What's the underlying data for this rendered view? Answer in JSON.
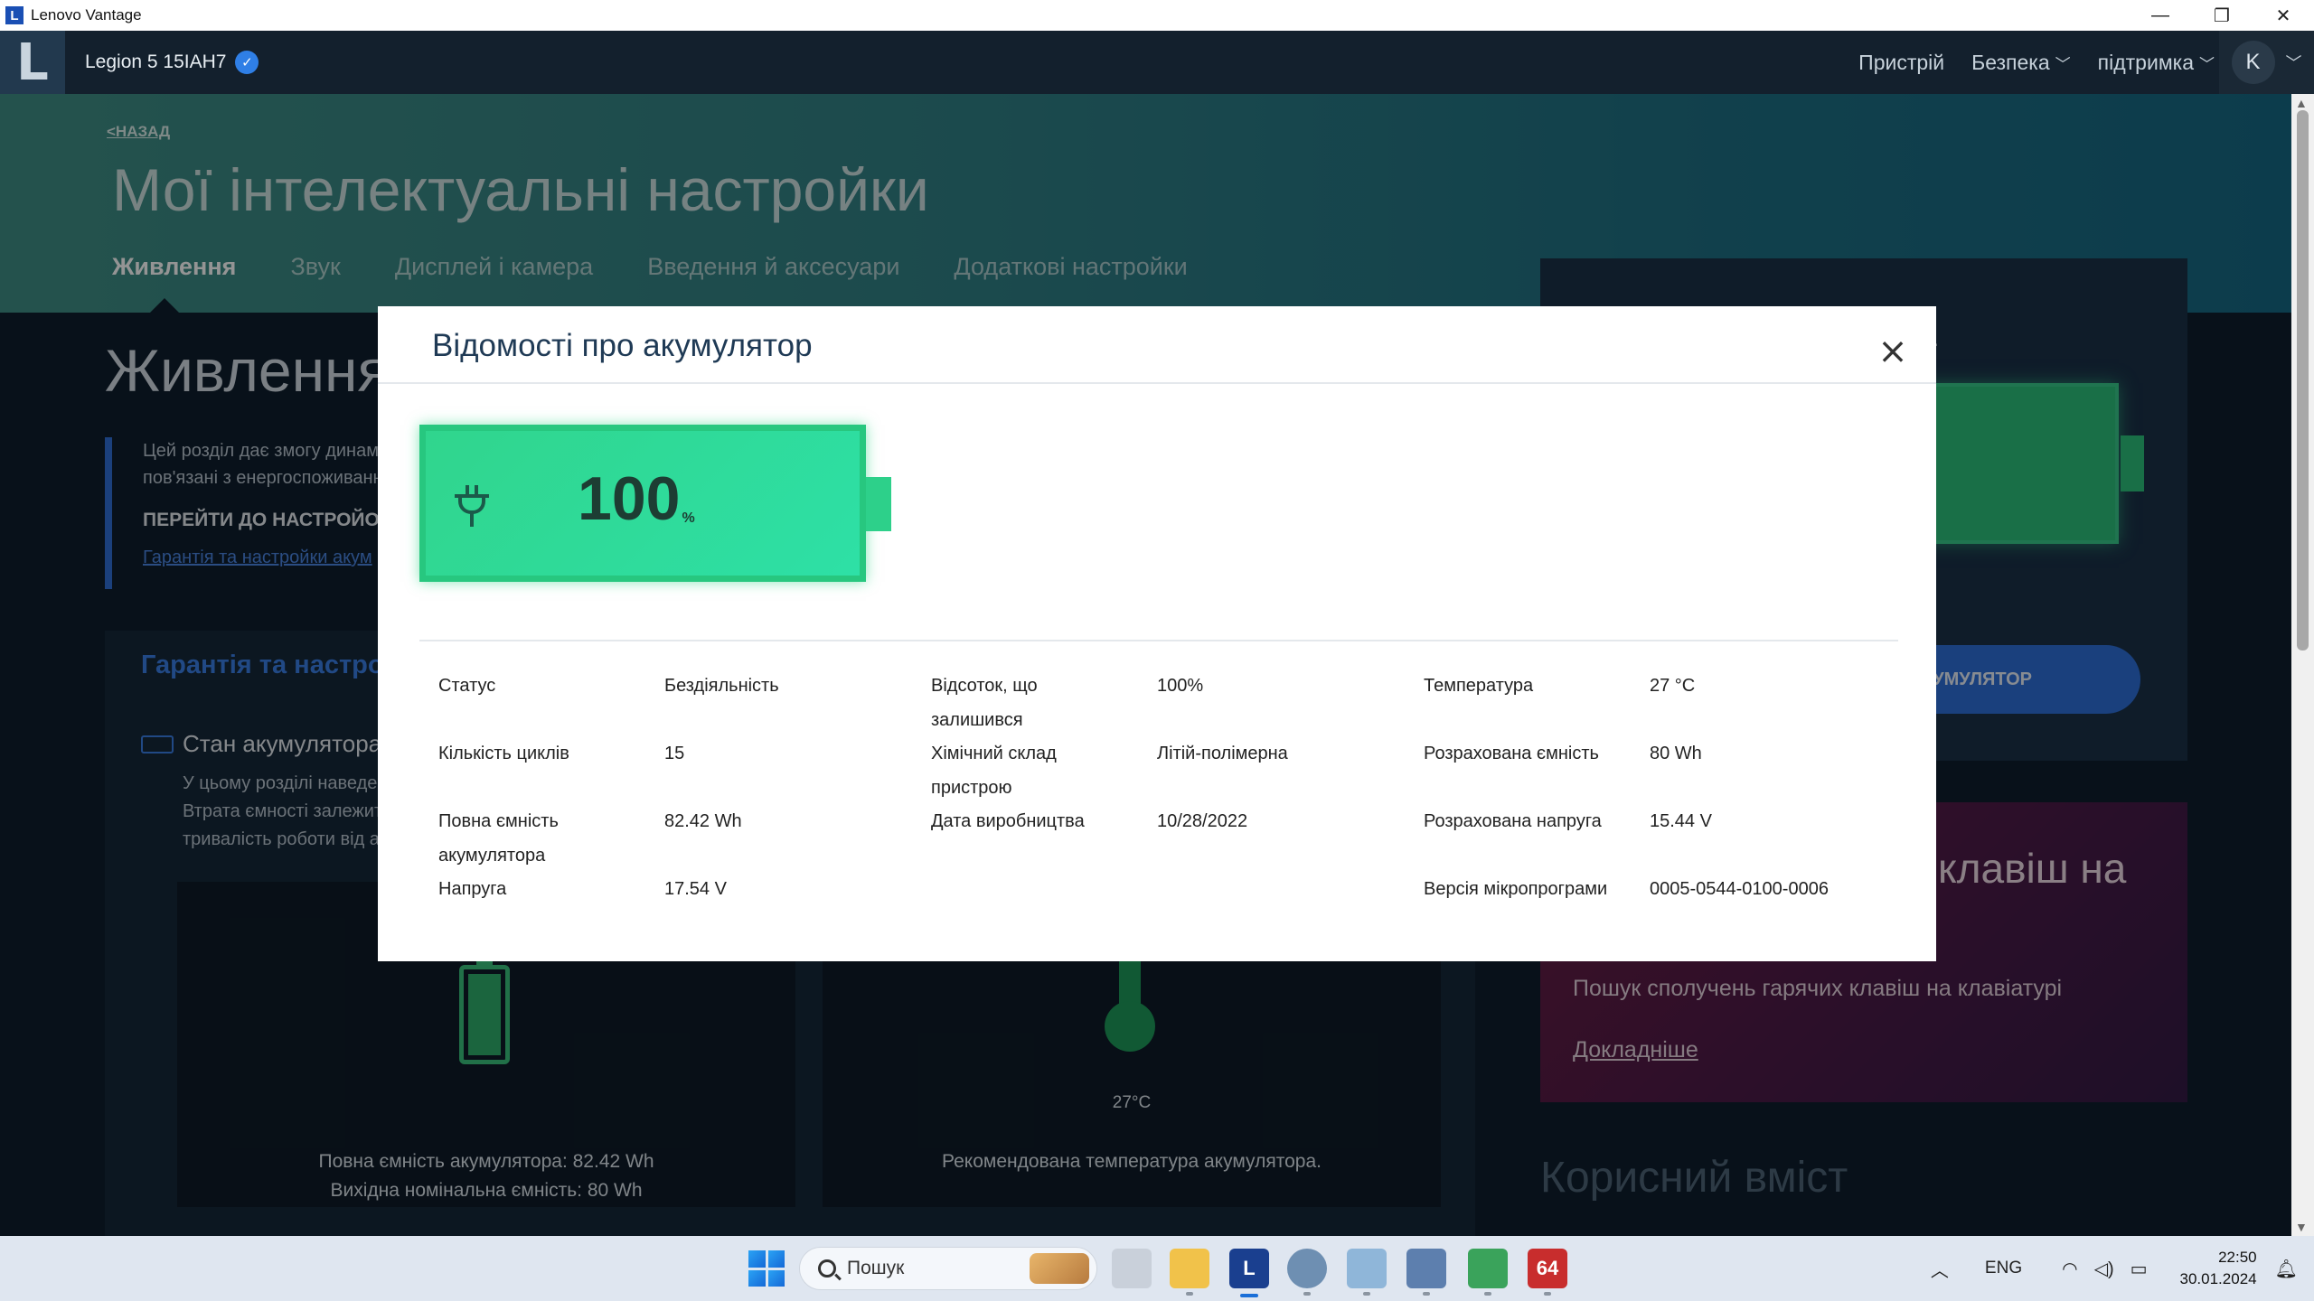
{
  "window": {
    "title": "Lenovo Vantage",
    "minimize": "—",
    "maximize": "❐",
    "close": "✕"
  },
  "header": {
    "logo": "L",
    "device": "Legion 5 15IAH7",
    "nav": [
      {
        "label": "Пристрій"
      },
      {
        "label": "Безпека"
      },
      {
        "label": "підтримка"
      }
    ],
    "user_initial": "K"
  },
  "hero": {
    "back": "<НАЗАД",
    "title": "Мої інтелектуальні настройки",
    "tabs": [
      "Живлення",
      "Звук",
      "Дисплей і камера",
      "Введення й аксесуари",
      "Додаткові настройки"
    ]
  },
  "background": {
    "section_title": "Живлення",
    "intro_line1": "Цей розділ дає змогу динам",
    "intro_line2": "пов'язані з енергоспоживанн",
    "intro_goto": "ПЕРЕЙТИ ДО НАСТРОЙОК",
    "intro_link": "Гарантія та настройки акум",
    "panel_title": "Гарантія та настро",
    "battery_state": "Стан акумулятора",
    "desc_line1": "У цьому розділі наведе",
    "desc_line2": "Втрата ємності залежит",
    "desc_line3": "тривалість роботи від а",
    "card1_line1": "Повна ємність акумулятора: 82.42 Wh",
    "card1_line2": "Вихідна номінальна ємність: 80 Wh",
    "card2_temp": "27°C",
    "card2_line": "Рекомендована температура акумулятора.",
    "right_heading": "а",
    "right_button": "УМУЛЯТОР",
    "promo_title": "клавіш на",
    "promo_text": "Пошук сполучень гарячих клавіш на клавіатурі",
    "promo_more": "Докладніше",
    "useful": "Корисний вміст"
  },
  "modal": {
    "title": "Відомості про акумулятор",
    "close": "×",
    "percent": "100",
    "percent_sign": "%",
    "col1": [
      {
        "label": "Статус",
        "value": "Бездіяльність"
      },
      {
        "label": "Кількість циклів",
        "value": "15"
      },
      {
        "label_l1": "Повна ємність",
        "label_l2": "акумулятора",
        "value": "82.42 Wh"
      },
      {
        "label": "Напруга",
        "value": "17.54 V"
      }
    ],
    "col2": [
      {
        "label_l1": "Відсоток, що",
        "label_l2": "залишився",
        "value": "100%"
      },
      {
        "label_l1": "Хімічний склад",
        "label_l2": "пристрою",
        "value": "Літій-полімерна"
      },
      {
        "label": "Дата виробництва",
        "value": "10/28/2022"
      }
    ],
    "col3": [
      {
        "label": "Температура",
        "value": "27 °C"
      },
      {
        "label": "Розрахована ємність",
        "value": "80 Wh"
      },
      {
        "label": "Розрахована напруга",
        "value": "15.44 V"
      },
      {
        "label": "Версія мікропрограми",
        "value": "0005-0544-0100-0006"
      }
    ]
  },
  "taskbar": {
    "search_placeholder": "Пошук",
    "lang": "ENG",
    "time": "22:50",
    "date": "30.01.2024",
    "app_badge": "64"
  }
}
